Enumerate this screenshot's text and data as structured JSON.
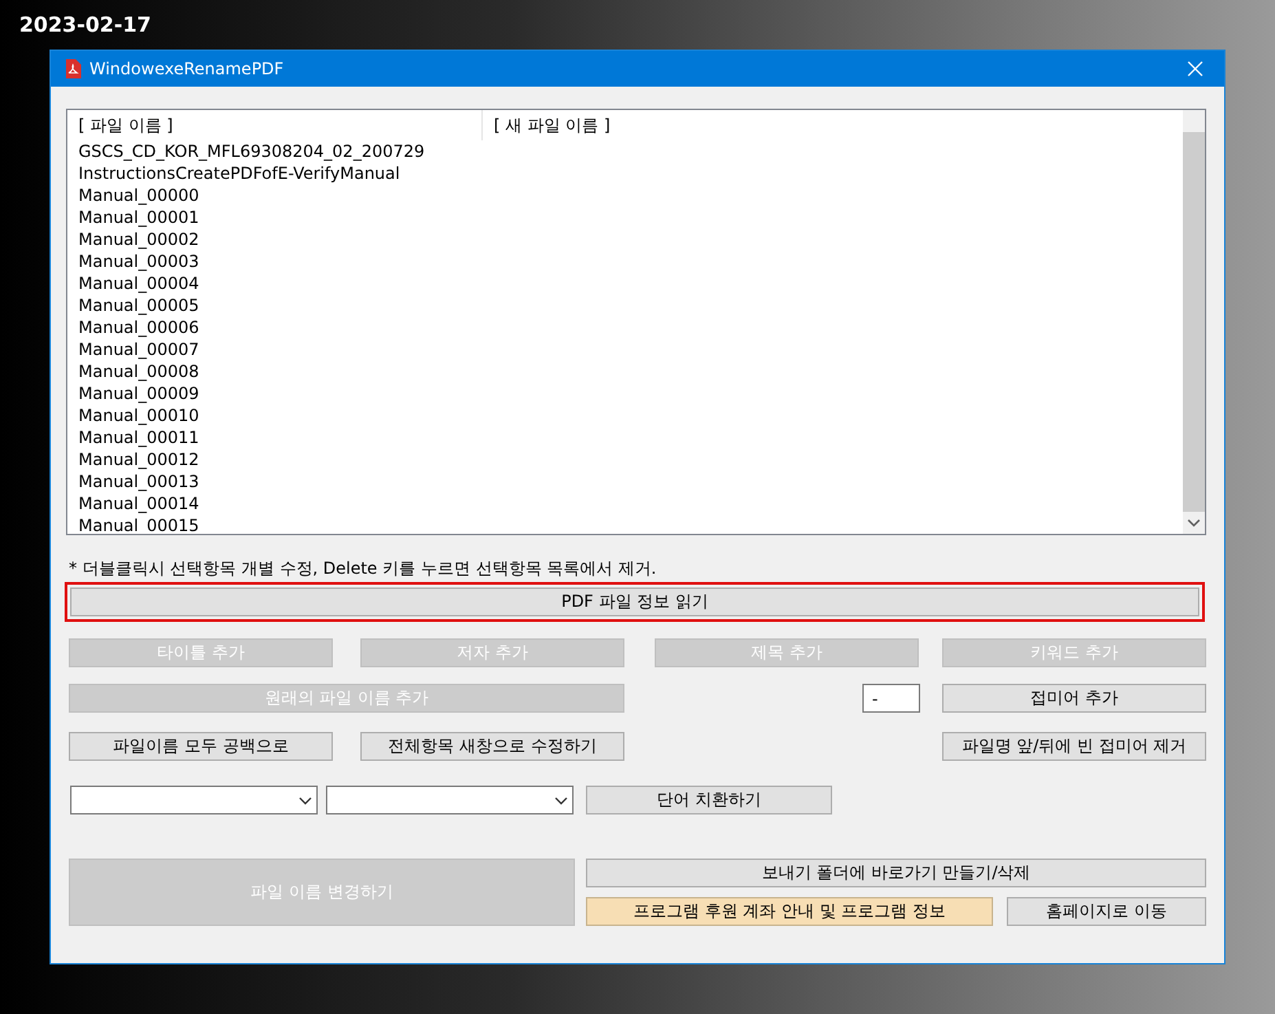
{
  "date": "2023-02-17",
  "window": {
    "title": "WindowexeRenamePDF"
  },
  "file_list": {
    "columns": [
      "[ 파일 이름 ]",
      "[ 새 파일 이름 ]"
    ],
    "files": [
      "GSCS_CD_KOR_MFL69308204_02_200729",
      "InstructionsCreatePDFofE-VerifyManual",
      "Manual_00000",
      "Manual_00001",
      "Manual_00002",
      "Manual_00003",
      "Manual_00004",
      "Manual_00005",
      "Manual_00006",
      "Manual_00007",
      "Manual_00008",
      "Manual_00009",
      "Manual_00010",
      "Manual_00011",
      "Manual_00012",
      "Manual_00013",
      "Manual_00014",
      "Manual_00015"
    ]
  },
  "hint": "* 더블클릭시 선택항목 개별 수정, Delete 키를 누르면 선택항목 목록에서 제거.",
  "read_button": {
    "label": "PDF 파일 정보 읽기",
    "outlined": true
  },
  "tag_buttons": [
    {
      "label": "타이틀 추가",
      "disabled": true
    },
    {
      "label": "저자 추가",
      "disabled": true
    },
    {
      "label": "제목 추가",
      "disabled": true
    },
    {
      "label": "키워드 추가",
      "disabled": true
    }
  ],
  "original_name_button": {
    "label": "원래의 파일 이름 추가",
    "disabled": true
  },
  "suffix_field": {
    "value": "-"
  },
  "suffix_button": {
    "label": "접미어 추가",
    "disabled": false
  },
  "blank_button": {
    "label": "파일이름 모두 공백으로",
    "disabled": false
  },
  "edit_all_button": {
    "label": "전체항목 새창으로 수정하기",
    "disabled": false
  },
  "remove_suffix_button": {
    "label": "파일명 앞/뒤에 빈 접미어 제거",
    "disabled": false
  },
  "replace_button": {
    "label": "단어 치환하기",
    "disabled": false
  },
  "rename_button": {
    "label": "파일 이름 변경하기",
    "disabled": true
  },
  "sendto_button": {
    "label": "보내기 폴더에 바로가기 만들기/삭제",
    "disabled": false
  },
  "donate_button": {
    "label": "프로그램 후원 계좌 안내 및 프로그램 정보",
    "disabled": false,
    "highlighted": true
  },
  "homepage_button": {
    "label": "홈페이지로 이동",
    "disabled": false
  }
}
